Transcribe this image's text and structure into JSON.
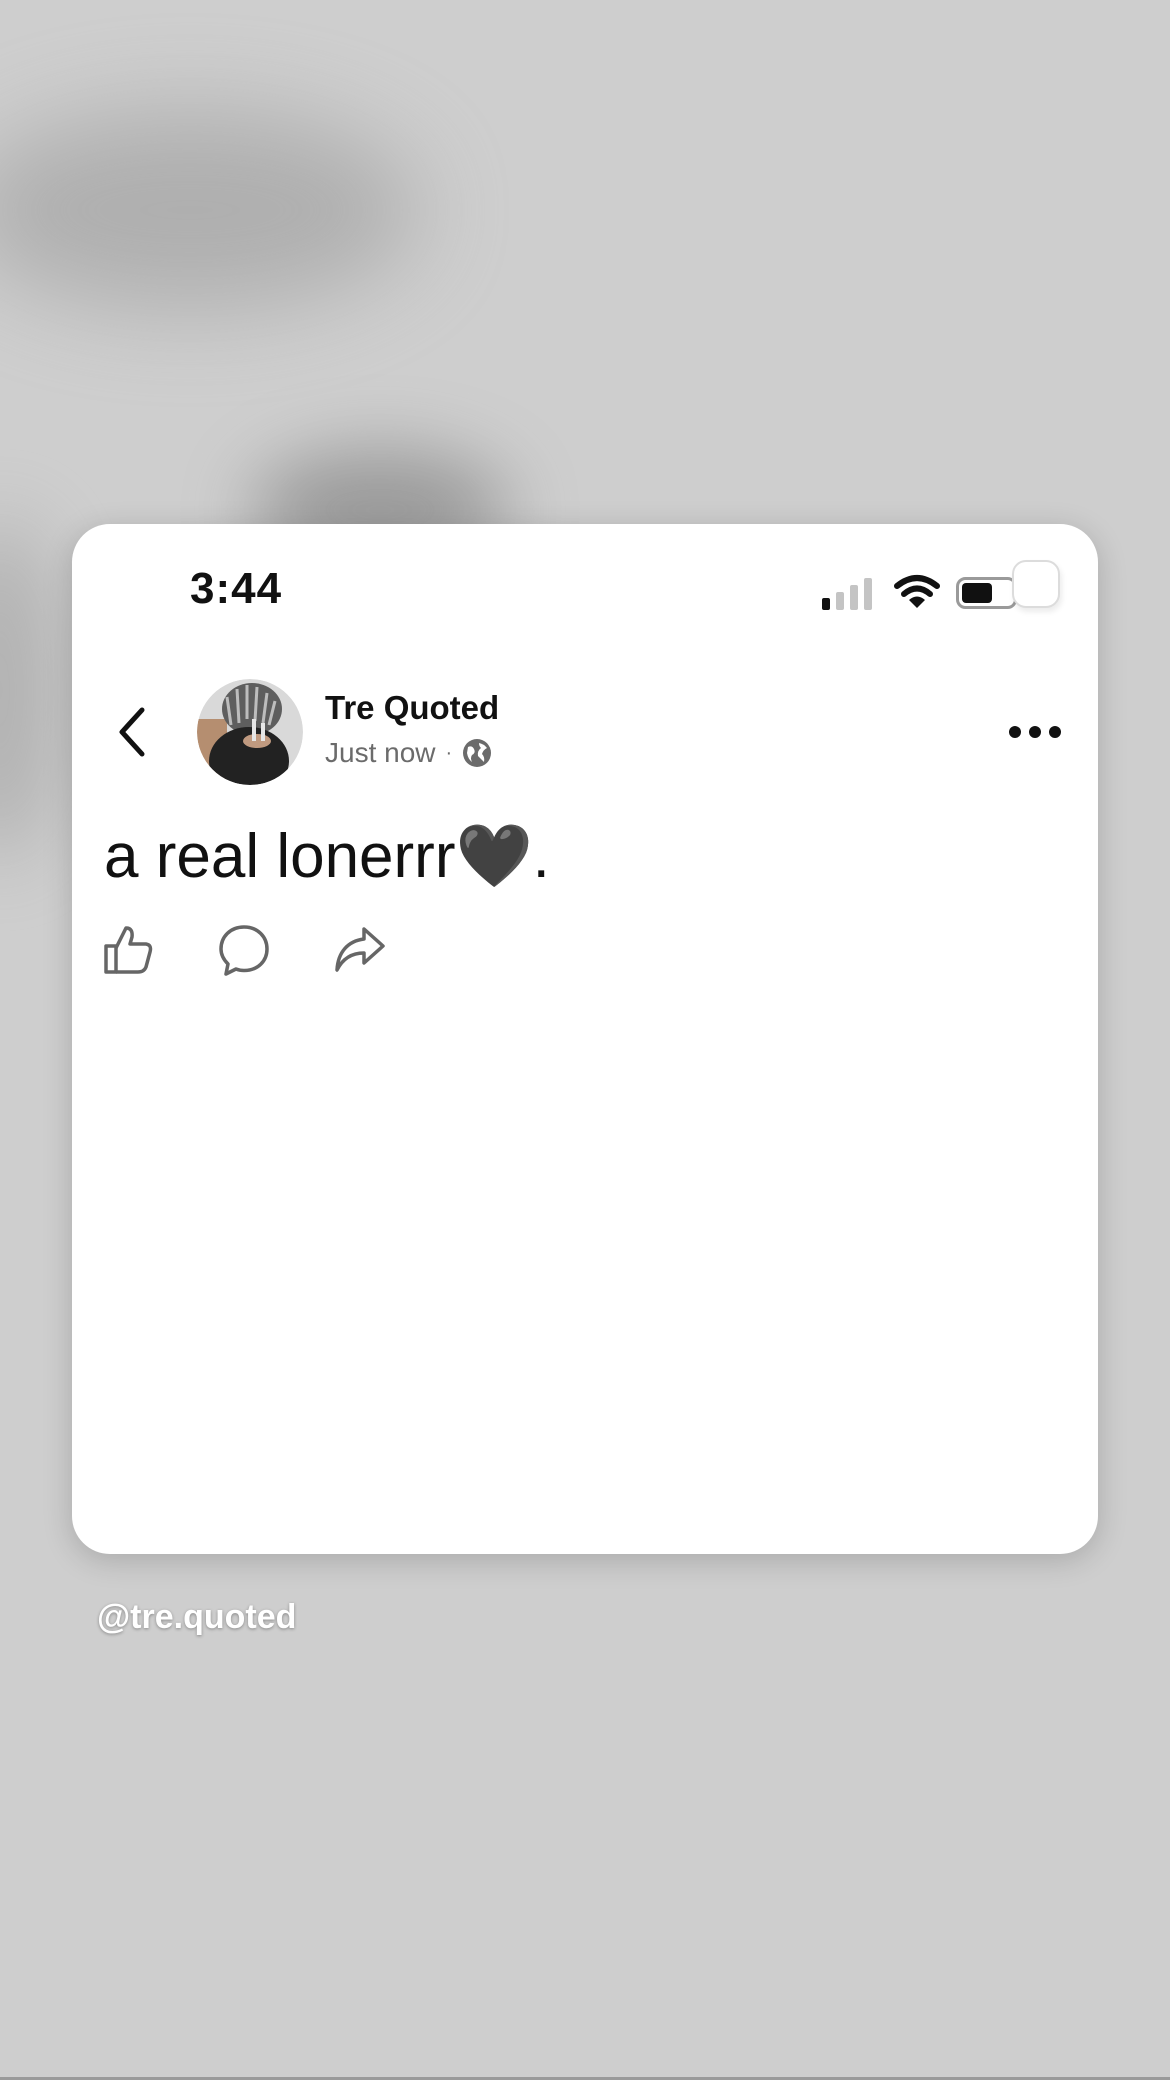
{
  "status_bar": {
    "time": "3:44"
  },
  "post": {
    "author": "Tre Quoted",
    "timestamp": "Just now",
    "separator": "·",
    "audience_icon": "globe-icon",
    "text": "a real lonerrr🖤."
  },
  "actions": [
    "like-icon",
    "comment-icon",
    "share-icon"
  ],
  "story": {
    "handle": "@tre.quoted"
  },
  "colors": {
    "background": "#cecece",
    "card": "#ffffff",
    "text": "#111111",
    "muted": "#6b6b6b"
  }
}
